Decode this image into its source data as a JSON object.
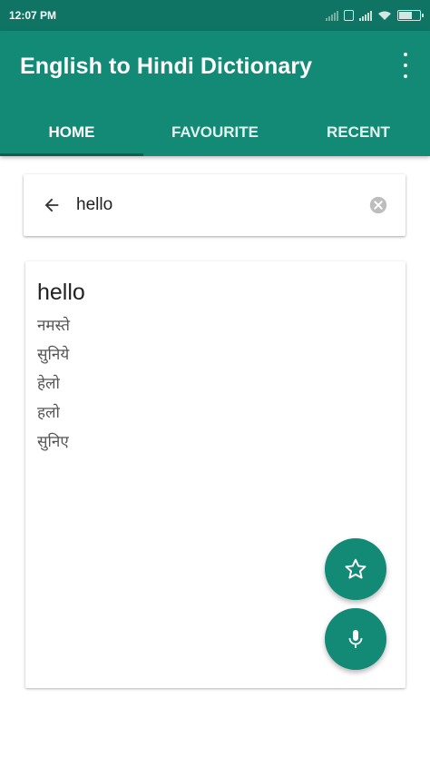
{
  "status_bar": {
    "time": "12:07 PM",
    "icons": [
      "signal-icon",
      "sim-icon",
      "signal-icon",
      "wifi-icon",
      "battery-icon"
    ]
  },
  "app_bar": {
    "title": "English to Hindi Dictionary",
    "menu_icon": "more-vertical-icon",
    "background_color": "#138a76"
  },
  "tabs": [
    {
      "label": "HOME",
      "selected": true
    },
    {
      "label": "FAVOURITE",
      "selected": false
    },
    {
      "label": "RECENT",
      "selected": false
    }
  ],
  "search": {
    "value": "hello",
    "back_icon": "arrow-left-icon",
    "clear_icon": "clear-circle-icon"
  },
  "result": {
    "word": "hello",
    "meanings": [
      "नमस्ते",
      "सुनिये",
      "हेलो",
      "हलो",
      "सुनिए"
    ]
  },
  "fabs": {
    "favourite_icon": "star-outline-icon",
    "voice_icon": "microphone-icon",
    "color": "#138a76"
  }
}
